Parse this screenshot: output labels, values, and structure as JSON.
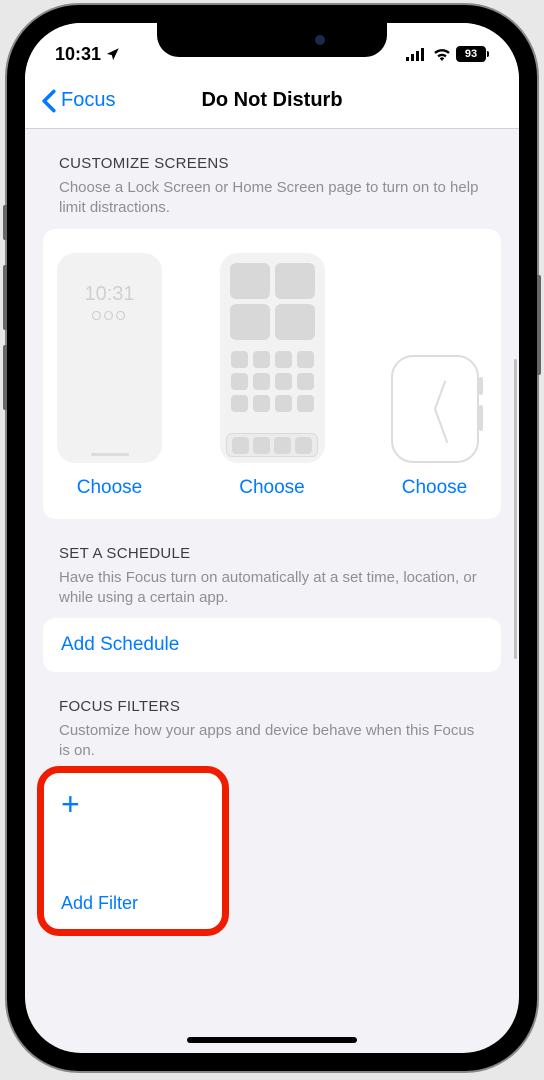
{
  "status": {
    "time": "10:31",
    "battery": "93"
  },
  "nav": {
    "back": "Focus",
    "title": "Do Not Disturb"
  },
  "customize": {
    "header": "CUSTOMIZE SCREENS",
    "sub": "Choose a Lock Screen or Home Screen page to turn on to help limit distractions.",
    "choose": "Choose",
    "lock_time": "10:31",
    "lock_dots": "OOO"
  },
  "schedule": {
    "header": "SET A SCHEDULE",
    "sub": "Have this Focus turn on automatically at a set time, location, or while using a certain app.",
    "action": "Add Schedule"
  },
  "filters": {
    "header": "FOCUS FILTERS",
    "sub": "Customize how your apps and device behave when this Focus is on.",
    "add": "Add Filter"
  }
}
